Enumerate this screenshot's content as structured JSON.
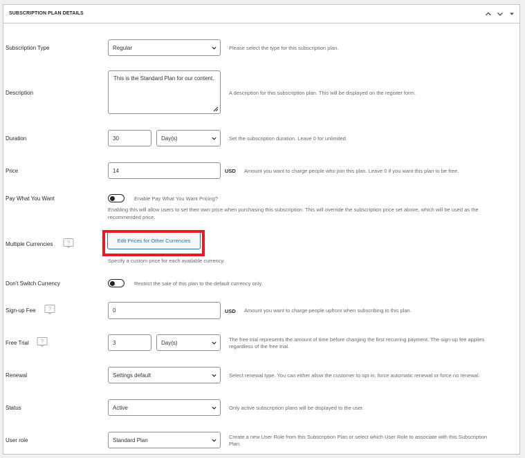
{
  "panel": {
    "title": "SUBSCRIPTION PLAN DETAILS"
  },
  "fields": {
    "subscription_type": {
      "label": "Subscription Type",
      "value": "Regular",
      "hint": "Please select the type for this subscription plan."
    },
    "description": {
      "label": "Description",
      "value": "This is the Standard Plan for our content.",
      "hint": "A description for this subscription plan. This will be displayed on the register form."
    },
    "duration": {
      "label": "Duration",
      "value": "30",
      "unit": "Day(s)",
      "hint": "Set the subscription duration. Leave 0 for unlimited."
    },
    "price": {
      "label": "Price",
      "value": "14",
      "currency": "USD",
      "hint": "Amount you want to charge people who join this plan. Leave 0 if you want this plan to be free."
    },
    "pay_what_you_want": {
      "label": "Pay What You Want",
      "toggle_label": "Enable Pay What You Want Pricing?",
      "hint_line1": "Enabling this will allow users to set their own price when purchasing this subscription. This will override the subscription price set above, which will be used as the",
      "hint_line2": "recommended price."
    },
    "multiple_currencies": {
      "label": "Multiple Currencies",
      "button": "Edit Prices for Other Currencies",
      "hint": "Specify a custom price for each available currency."
    },
    "dont_switch_currency": {
      "label": "Don't Switch Currency",
      "toggle_label": "Restrict the sale of this plan to the default currency only."
    },
    "signup_fee": {
      "label": "Sign-up Fee",
      "value": "0",
      "currency": "USD",
      "hint": "Amount you want to charge people upfront when subscribing to this plan."
    },
    "free_trial": {
      "label": "Free Trial",
      "value": "3",
      "unit": "Day(s)",
      "hint_line1": "The free trial represents the amount of time before charging the first recurring payment. The sign-up fee applies",
      "hint_line2": "regardless of the free trial."
    },
    "renewal": {
      "label": "Renewal",
      "value": "Settings default",
      "hint": "Select renewal type. You can either allow the customer to opt in, force automatic renewal or force no renewal."
    },
    "status": {
      "label": "Status",
      "value": "Active",
      "hint": "Only active subscription plans will be displayed to the user."
    },
    "user_role": {
      "label": "User role",
      "value": "Standard Plan",
      "hint_line1": "Create a new User Role from this Subscription Plan or select which User Role to associate with this Subscription",
      "hint_line2": "Plan."
    }
  },
  "colors": {
    "highlight": "#e51a23",
    "link": "#2271b1"
  },
  "icons": {
    "collapse_up": "chevron-up-icon",
    "collapse_down": "chevron-down-icon",
    "toggle_panel": "caret-down-icon",
    "help": "help-icon"
  }
}
